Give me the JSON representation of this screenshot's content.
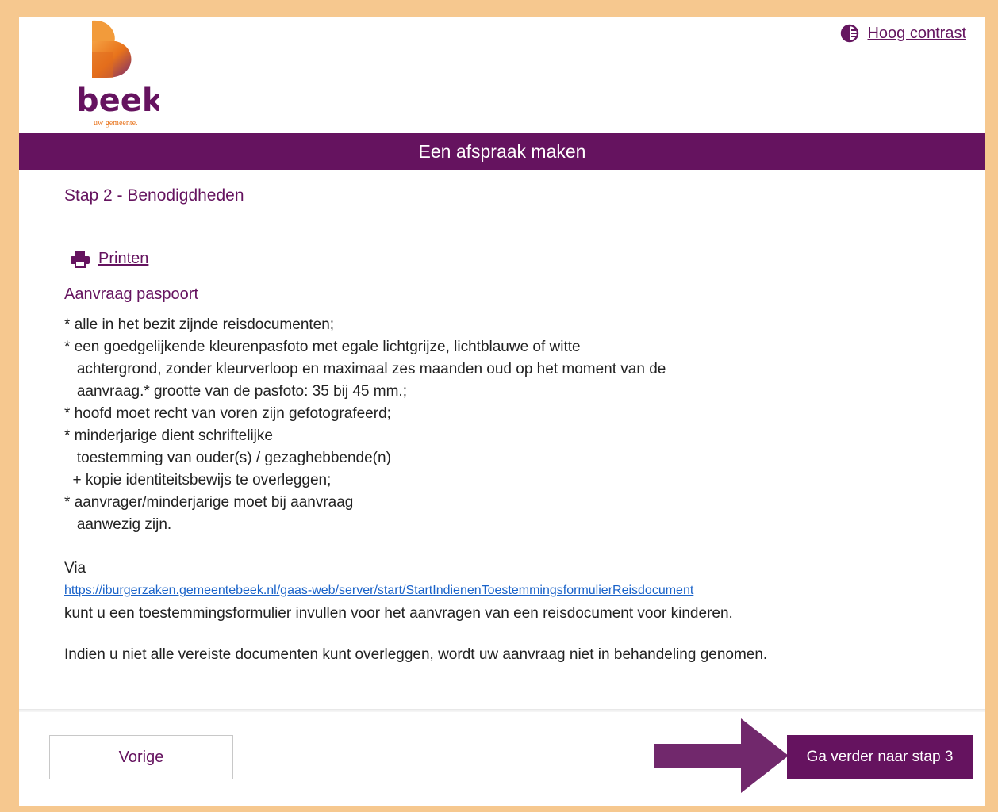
{
  "header": {
    "logo_text": "beek",
    "logo_tagline": "uw gemeente.",
    "contrast_label": "Hoog contrast",
    "contrast_icon": "half-circle-contrast-icon",
    "page_title": "Een afspraak maken"
  },
  "main": {
    "step_title": "Stap 2 - Benodigdheden",
    "print_label": "Printen",
    "print_icon": "printer-icon",
    "section_title": "Aanvraag paspoort",
    "requirements_text": "* alle in het bezit zijnde reisdocumenten;\n* een goedgelijkende kleurenpasfoto met egale lichtgrijze, lichtblauwe of witte\n   achtergrond, zonder kleurverloop en maximaal zes maanden oud op het moment van de\n   aanvraag.* grootte van de pasfoto: 35 bij 45 mm.;\n* hoofd moet recht van voren zijn gefotografeerd;\n* minderjarige dient schriftelijke\n   toestemming van ouder(s) / gezaghebbende(n)\n  + kopie identiteitsbewijs te overleggen;\n* aanvrager/minderjarige moet bij aanvraag\n   aanwezig zijn.",
    "via_label": "Via",
    "form_link": "https://iburgerzaken.gemeentebeek.nl/gaas-web/server/start/StartIndienenToestemmingsformulierReisdocument",
    "form_text": "kunt u een  toestemmingsformulier invullen voor het aanvragen van een reisdocument voor kinderen.",
    "notice_text": "Indien u niet alle vereiste documenten kunt overleggen, wordt uw aanvraag niet in behandeling genomen."
  },
  "footer": {
    "prev_label": "Vorige",
    "next_label": "Ga verder naar stap 3"
  },
  "colors": {
    "brand_purple": "#65135f",
    "frame_orange": "#f6c88f",
    "link_blue": "#1a63c9",
    "logo_orange": "#e8731b"
  }
}
